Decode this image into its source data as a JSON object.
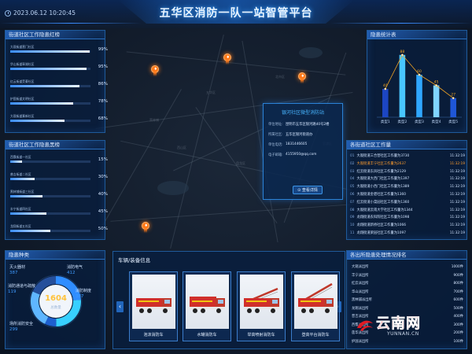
{
  "header": {
    "title": "五华区消防一队一站智管平台",
    "datetime": "2023.06.12 10:20:45"
  },
  "rate_panel": {
    "title": "街道社区工作隐患红榜",
    "items": [
      {
        "label": "大观街道营门社区",
        "pct": "99%",
        "value": 99
      },
      {
        "label": "华山街道翠湖社区",
        "pct": "95%",
        "value": 95
      },
      {
        "label": "红云街道茭菱社区",
        "pct": "86%",
        "value": 86
      },
      {
        "label": "护国街道文明社区",
        "pct": "78%",
        "value": 78
      },
      {
        "label": "大观街道篆新社区",
        "pct": "68%",
        "value": 68
      }
    ]
  },
  "black_panel": {
    "title": "街道社区工作隐患黑榜",
    "items": [
      {
        "label": "西翥街道一社区",
        "pct": "15%",
        "value": 15
      },
      {
        "label": "普吉街道二社区",
        "pct": "30%",
        "value": 30
      },
      {
        "label": "黑林铺街道三社区",
        "pct": "40%",
        "value": 40
      },
      {
        "label": "丰宁街道四社区",
        "pct": "45%",
        "value": 45
      },
      {
        "label": "龙翔街道五社区",
        "pct": "50%",
        "value": 50
      }
    ]
  },
  "hazard_types": {
    "title": "隐患种类",
    "total": "1604",
    "total_label": "总数量",
    "items": [
      {
        "label": "灭火器材",
        "value": "387"
      },
      {
        "label": "消防电气",
        "value": "412"
      },
      {
        "label": "消防通道与疏散",
        "value": "119"
      },
      {
        "label": "消防制度",
        "value": "387"
      },
      {
        "label": "场所消防安全",
        "value": "299"
      }
    ],
    "colors": [
      "#2f8dff",
      "#38d0ff",
      "#1e5fcf",
      "#5fb6ff",
      "#254f9b"
    ]
  },
  "popup": {
    "title": "银河社区微型消防站",
    "rows": [
      {
        "k": "单位地址:",
        "v": "昆明市五华区银河路40号2楼"
      },
      {
        "k": "所属社区:",
        "v": "五华区银河街道办"
      },
      {
        "k": "单位电话:",
        "v": "1831446605"
      },
      {
        "k": "电子邮箱:",
        "v": "4155950@qq.com"
      }
    ],
    "button": "查看详情"
  },
  "chart_panel": {
    "title": "隐患统计表"
  },
  "chart_data": {
    "type": "bar",
    "categories": [
      "类型1",
      "类型2",
      "类型3",
      "类型4",
      "类型5"
    ],
    "values": [
      40,
      88,
      60,
      45,
      27
    ],
    "series_line": [
      40,
      88,
      60,
      45,
      27
    ],
    "ylim": [
      0,
      100
    ],
    "bar_colors": [
      "#1c46c2",
      "#48c6ff",
      "#2fa7ff",
      "#7fd4ff",
      "#1f56d6"
    ],
    "line_color": "#f5a623"
  },
  "work_panel": {
    "title": "各街道社区工作量",
    "rows": [
      {
        "n": "01",
        "text": "大观街道三合营社区工作量为3730",
        "time": "11:32:19",
        "hi": false
      },
      {
        "n": "02",
        "text": "大观街道丰宁社区工作量为2637",
        "time": "11:32:19",
        "hi": true
      },
      {
        "n": "03",
        "text": "红云街道东风社区工作量为2129",
        "time": "11:32:19",
        "hi": false
      },
      {
        "n": "04",
        "text": "大观街道大西门社区工作量为1397",
        "time": "11:32:19",
        "hi": false
      },
      {
        "n": "05",
        "text": "大观街道小西门社区工作量为1389",
        "time": "11:32:19",
        "hi": false
      },
      {
        "n": "06",
        "text": "大观街道金碧社区工作量为1360",
        "time": "11:32:19",
        "hi": false
      },
      {
        "n": "07",
        "text": "红云街道小菜园社区工作量为1360",
        "time": "11:32:19",
        "hi": false
      },
      {
        "n": "08",
        "text": "大观街道云南大学社区工作量为1344",
        "time": "11:32:19",
        "hi": false
      },
      {
        "n": "09",
        "text": "龙翔街道农科院社区工作量为1098",
        "time": "11:32:19",
        "hi": false
      },
      {
        "n": "10",
        "text": "龙翔街道新桥社区工作量为1066",
        "time": "11:32:19",
        "hi": false
      },
      {
        "n": "11",
        "text": "龙翔街道梁园社区工作量为1097",
        "time": "11:32:19",
        "hi": false
      }
    ]
  },
  "station_panel": {
    "title": "各出所隐患处理情况排名",
    "rows": [
      {
        "text": "大观派出所",
        "num": "1000件"
      },
      {
        "text": "丰宁派出所",
        "num": "900件"
      },
      {
        "text": "红云派出所",
        "num": "800件"
      },
      {
        "text": "华山派出所",
        "num": "700件"
      },
      {
        "text": "黑林铺派出所",
        "num": "600件"
      },
      {
        "text": "龙翔派出所",
        "num": "500件"
      },
      {
        "text": "普吉派出所",
        "num": "400件"
      },
      {
        "text": "西翥派出所",
        "num": "300件"
      },
      {
        "text": "莲华派出所",
        "num": "200件"
      },
      {
        "text": "护国派出所",
        "num": "100件"
      }
    ]
  },
  "vehicles": {
    "title": "车辆/装备信息",
    "items": [
      {
        "name": "泡沫消防车"
      },
      {
        "name": "水罐消防车"
      },
      {
        "name": "举高喷射消防车"
      },
      {
        "name": "登高平台消防车"
      }
    ]
  },
  "watermark": {
    "text": "云南网",
    "domain": "YUNNAN.CN"
  }
}
